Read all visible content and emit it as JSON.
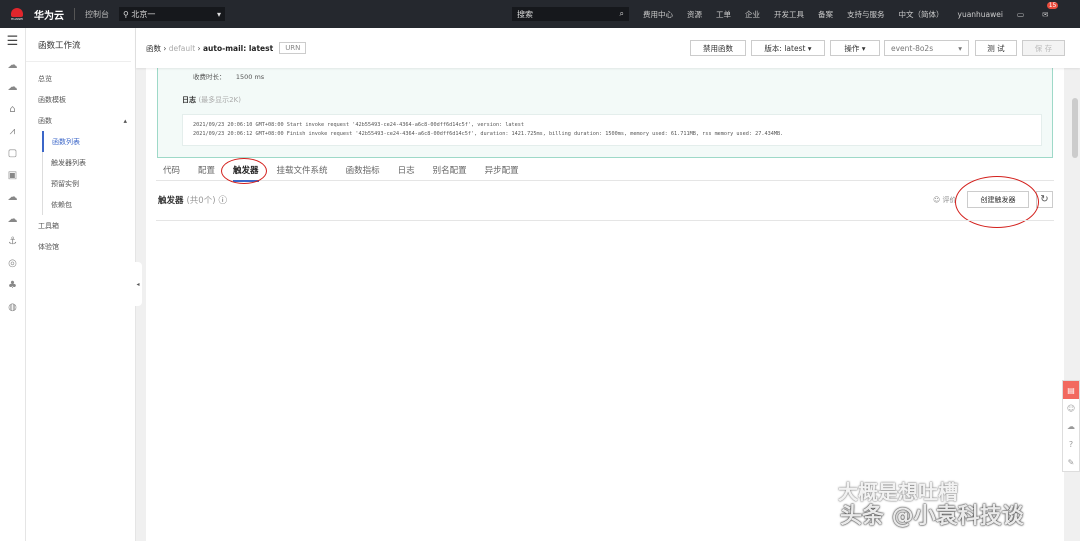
{
  "topbar": {
    "logo_text": "HUAWEI",
    "brand": "华为云",
    "console": "控制台",
    "region": "北京一",
    "search_placeholder": "搜索",
    "nav": [
      "费用中心",
      "资源",
      "工单",
      "企业",
      "开发工具",
      "备案",
      "支持与服务",
      "中文（简体）",
      "yuanhuawei"
    ],
    "badge": "15"
  },
  "sidebar": {
    "title": "函数工作流",
    "items": [
      {
        "label": "总览"
      },
      {
        "label": "函数模板"
      },
      {
        "label": "函数"
      }
    ],
    "sub_items": [
      {
        "label": "函数列表",
        "active": true
      },
      {
        "label": "触发器列表"
      },
      {
        "label": "预留实例"
      },
      {
        "label": "依赖包"
      }
    ],
    "bottom_items": [
      {
        "label": "工具箱"
      },
      {
        "label": "体验馆"
      }
    ]
  },
  "header": {
    "crumb_root": "函数",
    "crumb_mid": "default",
    "crumb_current": "auto-mail: latest",
    "urn": "URN",
    "disable": "禁用函数",
    "version": "版本: latest",
    "actions": "操作",
    "event": "event-8o2s",
    "test": "测 试",
    "save": "保 存"
  },
  "result": {
    "label": "收费时长：",
    "value": "1500 ms",
    "log_title": "日志",
    "log_note": "(最多显示2K)",
    "log_lines": [
      "2021/09/23 20:06:10 GMT+08:00 Start invoke request '42b55493-ce24-4364-a6c8-00dff6d14c5f', version: latest",
      "2021/09/23 20:06:12 GMT+08:00 Finish invoke request '42b55493-ce24-4364-a6c8-00dff6d14c5f', duration: 1421.725ms, billing duration: 1500ms, memory used: 61.711MB, rss memory used: 27.434MB."
    ]
  },
  "tabs": [
    "代码",
    "配置",
    "触发器",
    "挂载文件系统",
    "函数指标",
    "日志",
    "别名配置",
    "异步配置"
  ],
  "triggers": {
    "title": "触发器",
    "count": "(共0个)",
    "feedback": "评价",
    "create": "创建触发器"
  },
  "watermark": {
    "line1": "大概是想吐槽",
    "line2": "头条 @小袁科技谈"
  },
  "colors": {
    "accent": "#3b66c8",
    "annotation": "#d3201c"
  }
}
